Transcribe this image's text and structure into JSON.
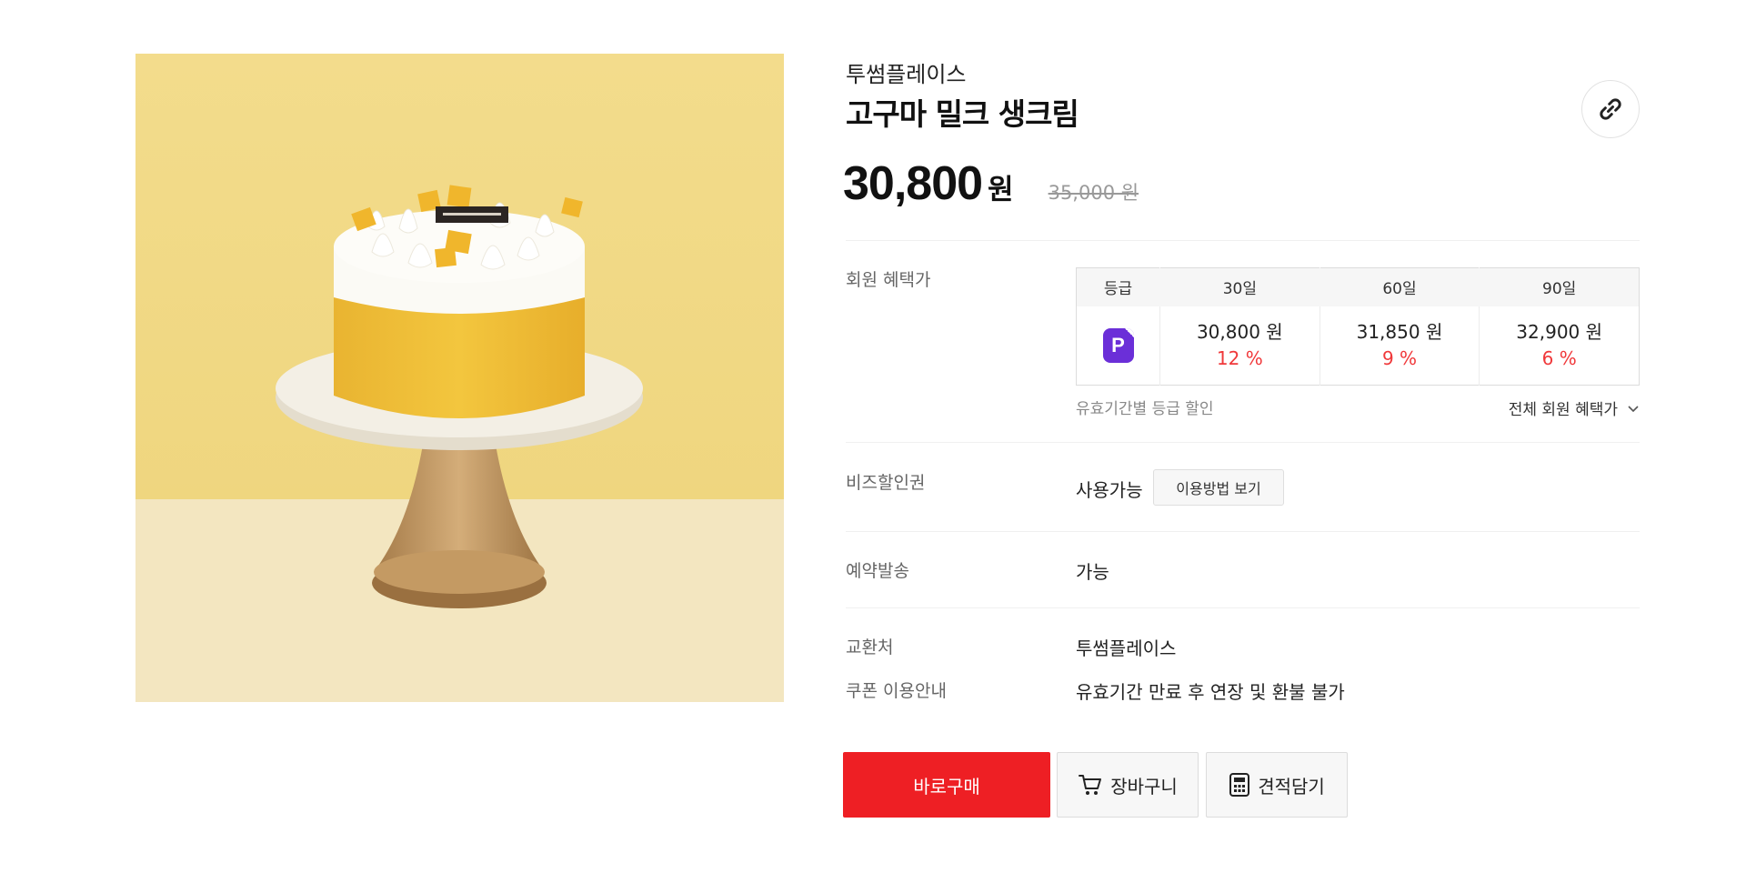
{
  "product": {
    "image_alt": "고구마 밀크 생크림",
    "brand": "투썸플레이스",
    "title": "고구마 밀크 생크림",
    "price": "30,800",
    "price_unit": "원",
    "original_price": "35,000 원",
    "share_icon": "link-icon"
  },
  "membership": {
    "label": "회원 혜택가",
    "headers": [
      "등급",
      "30일",
      "60일",
      "90일"
    ],
    "grade_icon": "P",
    "grade_icon_color": "#6b2fd8",
    "cells": [
      {
        "price": "30,800 원",
        "rate": "12 %"
      },
      {
        "price": "31,850 원",
        "rate": "9 %"
      },
      {
        "price": "32,900 원",
        "rate": "6 %"
      }
    ],
    "note": "유효기간별 등급 할인",
    "all_benefits": "전체 회원 혜택가"
  },
  "coupon": {
    "label": "비즈할인권",
    "status": "사용가능",
    "howto_button": "이용방법 보기"
  },
  "reservation": {
    "label": "예약발송",
    "value": "가능"
  },
  "exchange": {
    "label": "교환처",
    "value": "투썸플레이스"
  },
  "guide": {
    "label": "쿠폰 이용안내",
    "value": "유효기간 만료 후 연장 및 환불 불가"
  },
  "actions": {
    "buy": "바로구매",
    "cart": "장바구니",
    "quote": "견적담기"
  },
  "colors": {
    "accent_red": "#ee1f24",
    "rate_red": "#f0383a",
    "grade_purple": "#6b2fd8"
  }
}
